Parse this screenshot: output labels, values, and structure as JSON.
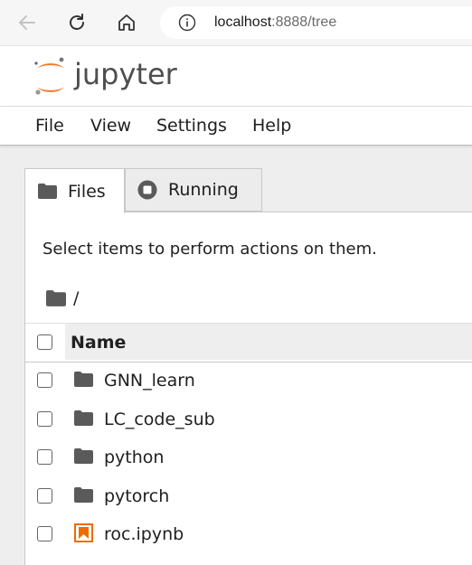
{
  "browser": {
    "url_host": "localhost",
    "url_path": ":8888/tree"
  },
  "app": {
    "logo_text": "jupyter"
  },
  "menu": {
    "items": [
      {
        "label": "File"
      },
      {
        "label": "View"
      },
      {
        "label": "Settings"
      },
      {
        "label": "Help"
      }
    ]
  },
  "tabs": [
    {
      "label": "Files",
      "icon": "folder-icon",
      "active": true
    },
    {
      "label": "Running",
      "icon": "stop-circle-icon",
      "active": false
    }
  ],
  "files_panel": {
    "hint": "Select items to perform actions on them.",
    "breadcrumb": "/",
    "column_name": "Name",
    "items": [
      {
        "name": "GNN_learn",
        "type": "folder",
        "icon": "folder-icon"
      },
      {
        "name": "LC_code_sub",
        "type": "folder",
        "icon": "folder-icon"
      },
      {
        "name": "python",
        "type": "folder",
        "icon": "folder-icon"
      },
      {
        "name": "pytorch",
        "type": "folder",
        "icon": "folder-icon"
      },
      {
        "name": "roc.ipynb",
        "type": "notebook",
        "icon": "notebook-icon"
      }
    ]
  },
  "colors": {
    "jupyter_orange": "#f37726",
    "folder_gray": "#5a5a5a",
    "notebook_orange": "#ef6c00"
  }
}
